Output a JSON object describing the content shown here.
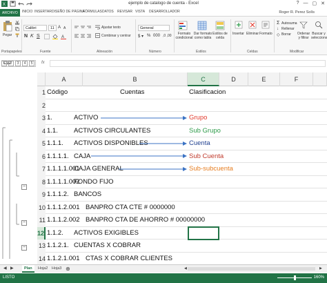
{
  "titlebar": {
    "doc_title": "ejemplo de catalogo de cuenta - Excel",
    "window_buttons": [
      "?",
      "—",
      "▢",
      "✕"
    ]
  },
  "tabs": [
    "ARCHIVO",
    "INICIO",
    "INSERTAR",
    "DISEÑO DE PÁGINA",
    "FÓRMULAS",
    "DATOS",
    "REVISAR",
    "VISTA",
    "DESARROLLADOR"
  ],
  "user": "Roger R. Perez Solís",
  "ribbon": {
    "paste": "Pegar",
    "font_name": "Calibri",
    "font_size": "11",
    "wrap_text": "Ajustar texto",
    "merge": "Combinar y centrar",
    "number_format": "General",
    "cond_format": "Formato condicional",
    "format_table": "Dar formato como tabla",
    "cell_styles": "Estilos de celda",
    "insert": "Insertar",
    "delete": "Eliminar",
    "format": "Formato",
    "autosum": "Autosuma",
    "fill": "Rellenar",
    "clear": "Borrar",
    "sort": "Ordenar y filtrar",
    "find": "Buscar y seleccionar",
    "groups": [
      "Portapapeles",
      "Fuente",
      "Alineación",
      "Número",
      "Estilos",
      "Celdas",
      "Modificar"
    ]
  },
  "formula": {
    "namebox": "C12",
    "fx": "fx",
    "value": ""
  },
  "outline_levels": [
    "1",
    "2",
    "3",
    "4",
    "5"
  ],
  "columns": [
    "A",
    "B",
    "C",
    "D",
    "E",
    "F"
  ],
  "rows": [
    {
      "num": "1",
      "a": "Código",
      "b": "Cuentas",
      "c": "Clasificacion",
      "c_color": "#111111"
    },
    {
      "num": "2",
      "a": "",
      "b": "",
      "c": "",
      "c_color": "#111111"
    },
    {
      "num": "3",
      "a": "1.",
      "b": "ACTIVO",
      "c": "Grupo",
      "c_color": "#e23b2e"
    },
    {
      "num": "4",
      "a": "1.1.",
      "b": "ACTIVOS CIRCULANTES",
      "c": "Sub Grupo",
      "c_color": "#2e9b4a"
    },
    {
      "num": "5",
      "a": "1.1.1.",
      "b": "ACTIVOS DISPONIBLES",
      "c": "Cuenta",
      "c_color": "#1f3f8f"
    },
    {
      "num": "6",
      "a": "1.1.1.1.",
      "b": "CAJA",
      "c": "Sub Cuenta",
      "c_color": "#c0392b"
    },
    {
      "num": "7",
      "a": "1.1.1.1.001",
      "b": "CAJA GENERAL",
      "c": "Sub-subcuenta",
      "c_color": "#e67e22"
    },
    {
      "num": "8",
      "a": "1.1.1.1.002",
      "b": "FONDO FIJO",
      "c": "",
      "c_color": "#111111"
    },
    {
      "num": "9",
      "a": "1.1.1.2.",
      "b": "BANCOS",
      "c": "",
      "c_color": "#111111"
    },
    {
      "num": "10",
      "a": "1.1.1.2.001",
      "b": "BANPRO CTA CTE # 0000000",
      "c": "",
      "c_color": "#111111"
    },
    {
      "num": "11",
      "a": "1.1.1.2.002",
      "b": "BANPRO CTA DE AHORRO # 00000000",
      "c": "",
      "c_color": "#111111"
    },
    {
      "num": "12",
      "a": "1.1.2.",
      "b": "ACTIVOS EXIGIBLES",
      "c": "",
      "c_color": "#111111"
    },
    {
      "num": "13",
      "a": "1.1.2.1.",
      "b": "CUENTAS X COBRAR",
      "c": "",
      "c_color": "#111111"
    },
    {
      "num": "14",
      "a": "1.1.2.1.001",
      "b": "CTAS X COBRAR CLIENTES",
      "c": "",
      "c_color": "#111111"
    }
  ],
  "sheets": [
    "Plan",
    "Hoja2",
    "Hoja3"
  ],
  "status": {
    "ready": "LISTO",
    "zoom": "160%"
  },
  "colors": {
    "excel_green": "#217346",
    "arrow": "#3b73c4"
  }
}
